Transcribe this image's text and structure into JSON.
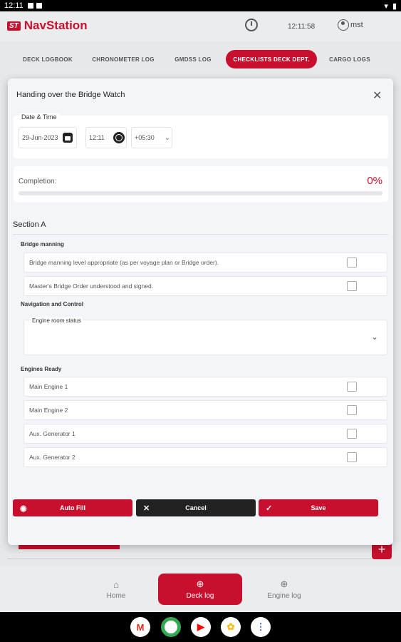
{
  "status_bar": {
    "time": "12:11"
  },
  "header": {
    "logo_badge": "ST",
    "app_name": "NavStation",
    "clock_time": "12:11:58",
    "username": "mst"
  },
  "tabs": [
    {
      "label": "DECK LOGBOOK",
      "active": false
    },
    {
      "label": "CHRONOMETER LOG",
      "active": false
    },
    {
      "label": "GMDSS LOG",
      "active": false
    },
    {
      "label": "CHECKLISTS DECK DEPT.",
      "active": true
    },
    {
      "label": "CARGO LOGS",
      "active": false
    }
  ],
  "modal": {
    "title": "Handing over the Bridge Watch",
    "datetime": {
      "legend": "Date & Time",
      "date": "29-Jun-2023",
      "time": "12:11",
      "timezone": "+05:30"
    },
    "completion": {
      "label": "Completion:",
      "value": "0%",
      "fraction": 0
    },
    "section": {
      "title": "Section A",
      "groups": [
        {
          "title": "Bridge manning",
          "items": [
            "Bridge manning level appropriate (as per voyage plan or Bridge order).",
            "Master's Bridge Order understood and signed."
          ]
        },
        {
          "title": "Navigation and Control",
          "select_label": "Engine room status",
          "select_value": ""
        },
        {
          "title": "Engines Ready",
          "items": [
            "Main Engine 1",
            "Main Engine 2",
            "Aux. Generator 1",
            "Aux. Generator 2"
          ]
        }
      ]
    },
    "buttons": {
      "autofill": "Auto Fill",
      "cancel": "Cancel",
      "save": "Save"
    }
  },
  "bottom_nav": [
    {
      "label": "Home",
      "active": false
    },
    {
      "label": "Deck log",
      "active": true
    },
    {
      "label": "Engine log",
      "active": false
    }
  ],
  "colors": {
    "accent": "#c8102e",
    "dark": "#222222",
    "modal_bg": "#f3f5f8"
  }
}
